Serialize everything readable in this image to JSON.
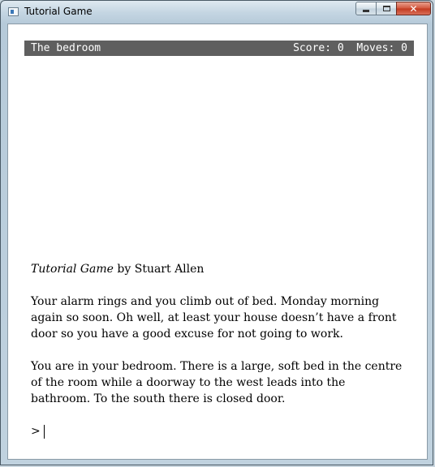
{
  "window": {
    "title": "Tutorial Game",
    "controls": {
      "minimize": "–",
      "maximize": "□",
      "close": "✕"
    }
  },
  "status": {
    "room": "The bedroom",
    "score_label": "Score:",
    "score": "0",
    "moves_label": "Moves:",
    "moves": "0"
  },
  "story": {
    "game_title": "Tutorial Game",
    "byline": " by Stuart Allen",
    "intro": "Your alarm rings and you climb out of bed. Monday morning again so soon. Oh well, at least your house doesn’t have a front door so you have a good excuse for not going to work.",
    "description": "You are in your bedroom. There is a large, soft bed in the centre of the room while a doorway to the west leads into the bathroom. To the south there is closed door.",
    "prompt": ">",
    "command": ""
  }
}
